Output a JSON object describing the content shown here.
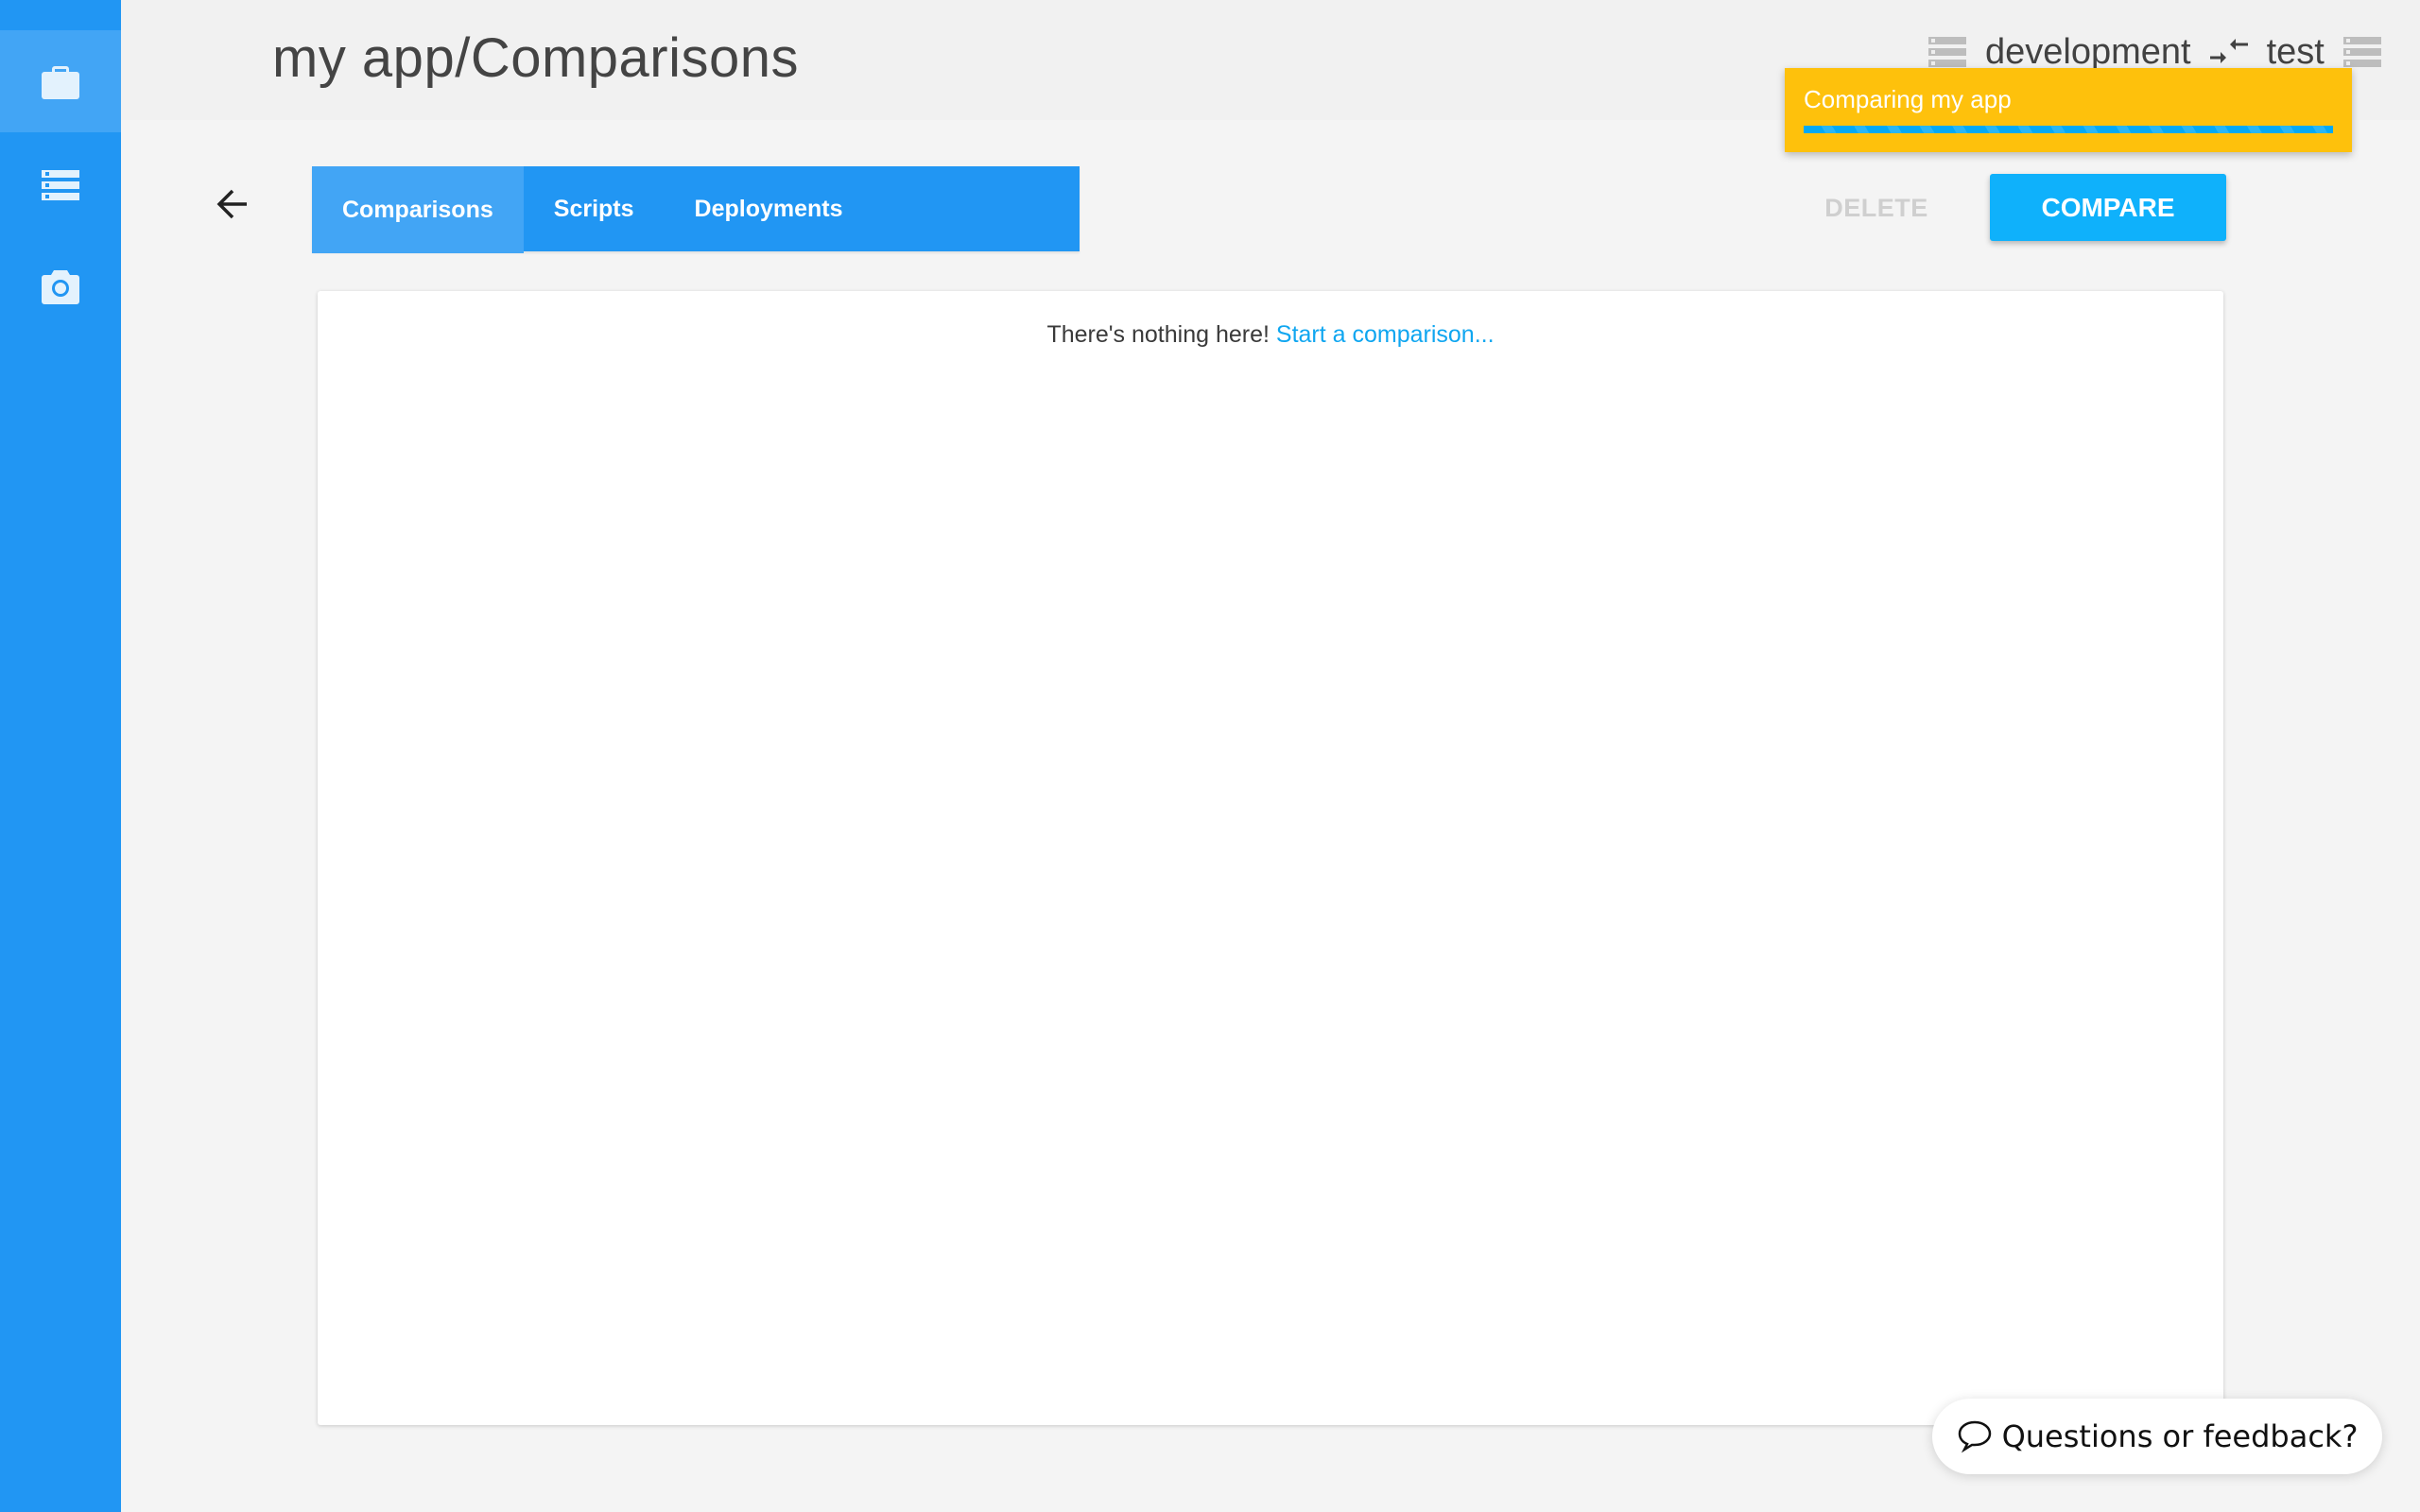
{
  "sidebar": {
    "items": [
      {
        "icon": "briefcase-icon",
        "active": true
      },
      {
        "icon": "servers-icon",
        "active": false
      },
      {
        "icon": "camera-icon",
        "active": false
      }
    ]
  },
  "header": {
    "title": "my app/Comparisons",
    "source_env": "development",
    "target_env": "test"
  },
  "tabs": [
    {
      "label": "Comparisons",
      "active": true
    },
    {
      "label": "Scripts",
      "active": false
    },
    {
      "label": "Deployments",
      "active": false
    }
  ],
  "actions": {
    "delete_label": "DELETE",
    "compare_label": "COMPARE"
  },
  "content": {
    "empty_text": "There's nothing here!",
    "empty_link": "Start a comparison..."
  },
  "toast": {
    "message": "Comparing my app",
    "progress": "indeterminate"
  },
  "feedback": {
    "label": "Questions or feedback?"
  },
  "colors": {
    "primary": "#2196f3",
    "primary_light": "#42a5f5",
    "accent": "#0fb1fb",
    "toast": "#fec10c",
    "link": "#0fa6f0"
  }
}
